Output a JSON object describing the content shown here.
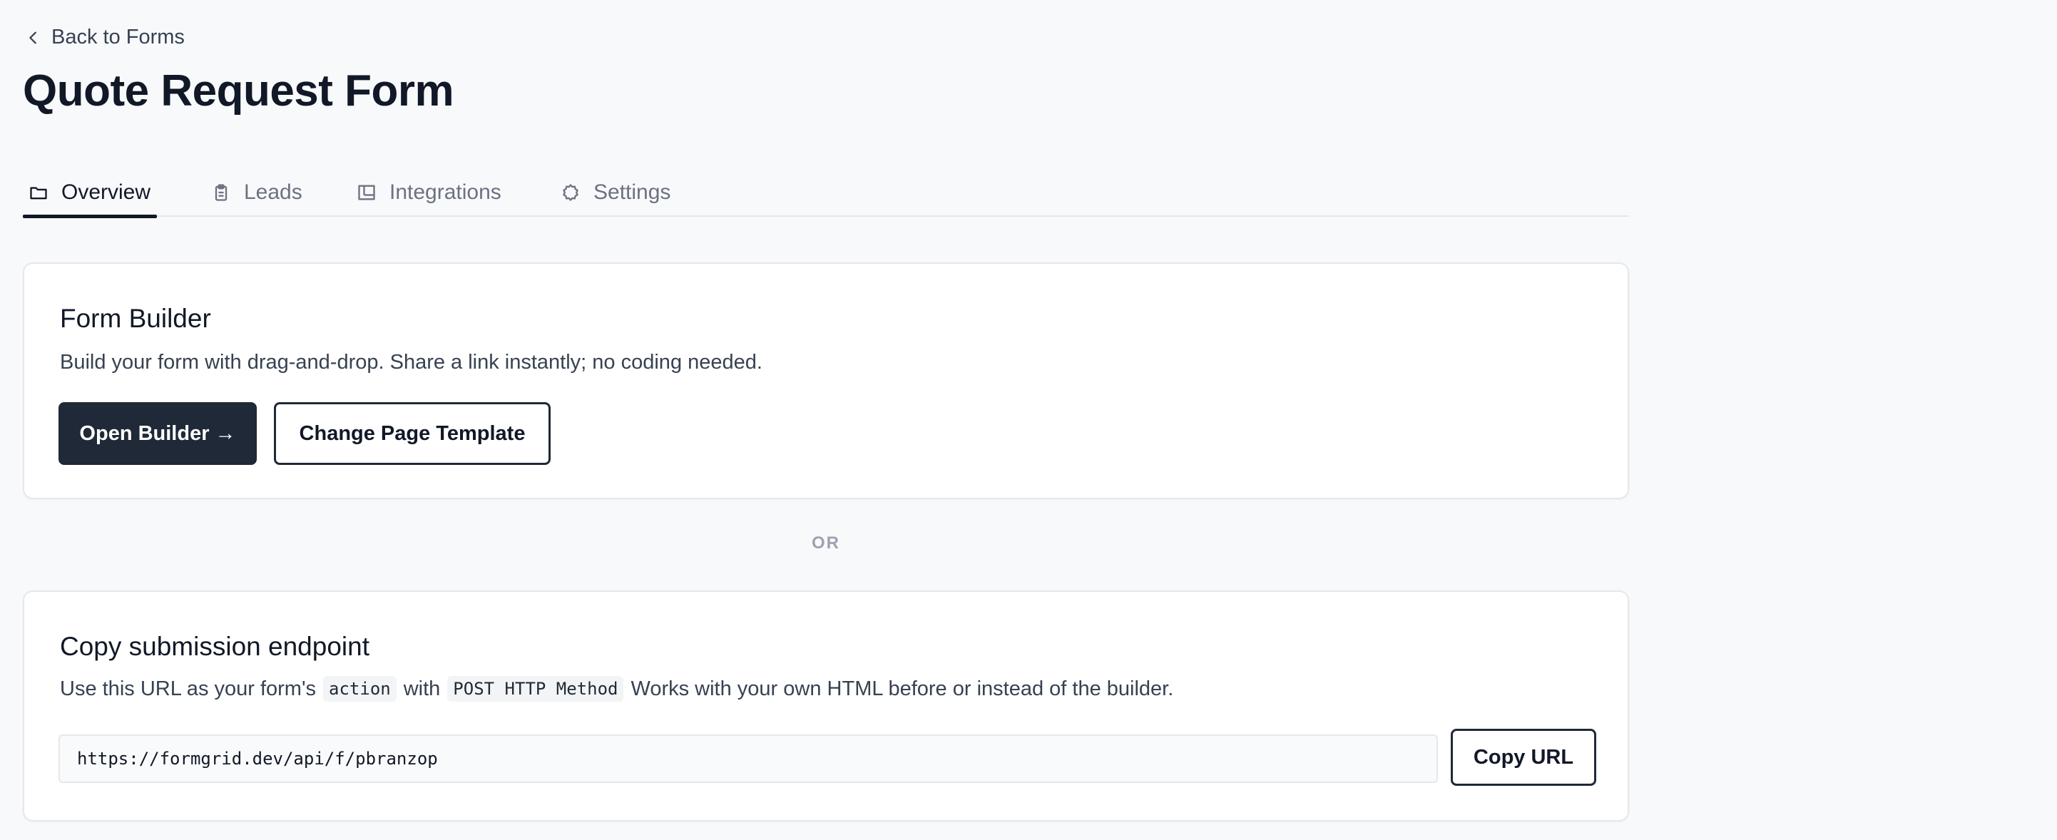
{
  "back_link": {
    "label": "Back to Forms",
    "icon": "chevron-left-icon"
  },
  "page_title": "Quote Request Form",
  "tabs": [
    {
      "label": "Overview",
      "icon": "folder-icon",
      "active": true
    },
    {
      "label": "Leads",
      "icon": "clipboard-icon",
      "active": false
    },
    {
      "label": "Integrations",
      "icon": "layout-icon",
      "active": false
    },
    {
      "label": "Settings",
      "icon": "gear-icon",
      "active": false
    }
  ],
  "form_builder": {
    "title": "Form Builder",
    "description": "Build your form with drag-and-drop. Share a link instantly; no coding needed.",
    "open_button": "Open Builder →",
    "template_button": "Change Page Template"
  },
  "divider": "OR",
  "endpoint": {
    "title": "Copy submission endpoint",
    "desc_prefix": "Use this URL as your form's",
    "code_action": "action",
    "desc_with": "with",
    "code_method": "POST HTTP Method",
    "desc_suffix": "Works with your own HTML before or instead of the builder.",
    "url": "https://formgrid.dev/api/f/pbranzop",
    "copy_button": "Copy URL"
  },
  "colors": {
    "background": "#f8f9fb",
    "primary_button": "#1f2937",
    "text": "#111827",
    "muted": "#6b7280"
  }
}
